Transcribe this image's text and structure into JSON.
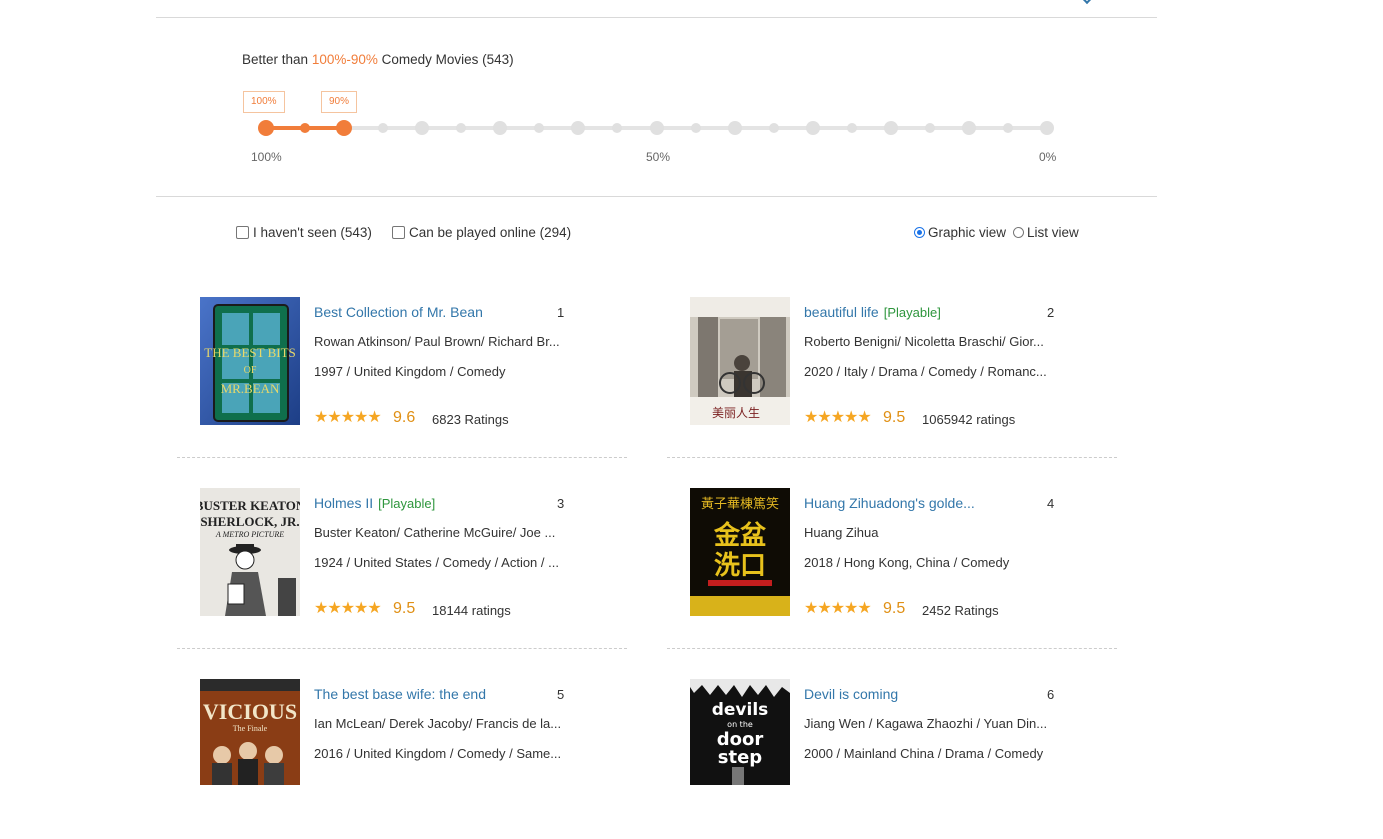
{
  "filter": {
    "prefix": "Better than",
    "range": "100%-90%",
    "suffix": "Comedy Movies (543)",
    "box_left": "100%",
    "box_right": "90%",
    "tick_left": "100%",
    "tick_mid": "50%",
    "tick_right": "0%",
    "selected_from_percent": 100,
    "selected_to_percent": 90
  },
  "options": {
    "not_seen": {
      "label": "I haven't seen",
      "count": "(543)",
      "checked": false
    },
    "playable": {
      "label": "Can be played online",
      "count": "(294)",
      "checked": false
    },
    "view_graphic": "Graphic view",
    "view_list": "List view",
    "selected_view": "Graphic view"
  },
  "colors": {
    "accent": "#f17d3a",
    "link": "#3377aa",
    "playable": "#2e963d",
    "star": "#f5a623"
  },
  "movies": [
    {
      "rank": "1",
      "title": "Best Collection of Mr. Bean",
      "playable": "",
      "cast": "Rowan Atkinson/ Paul Brown/ Richard Br...",
      "info": "1997 / United Kingdom / Comedy",
      "stars": "★★★★★",
      "score": "9.6",
      "votes": "6823 Ratings",
      "poster_text": "THE BEST BITS OF MR.BEAN"
    },
    {
      "rank": "2",
      "title": "beautiful life",
      "playable": "[Playable]",
      "cast": "Roberto Benigni/ Nicoletta Braschi/ Gior...",
      "info": "2020 / Italy / Drama / Comedy / Romanc...",
      "stars": "★★★★★",
      "score": "9.5",
      "votes": "1065942 ratings",
      "poster_text": "美丽人生"
    },
    {
      "rank": "3",
      "title": "Holmes II",
      "playable": "[Playable]",
      "cast": "Buster Keaton/ Catherine McGuire/ Joe ...",
      "info": "1924 / United States / Comedy / Action / ...",
      "stars": "★★★★★",
      "score": "9.5",
      "votes": "18144 ratings",
      "poster_text": "BUSTER KEATON SHERLOCK, JR."
    },
    {
      "rank": "4",
      "title": "Huang Zihuadong's golde...",
      "playable": "",
      "cast": "Huang Zihua",
      "info": "2018 / Hong Kong, China / Comedy",
      "stars": "★★★★★",
      "score": "9.5",
      "votes": "2452 Ratings",
      "poster_text": "金盆洗口"
    },
    {
      "rank": "5",
      "title": "The best base wife: the end",
      "playable": "",
      "cast": "Ian McLean/ Derek Jacoby/ Francis de la...",
      "info": "2016 / United Kingdom / Comedy / Same...",
      "stars": "★★★★★",
      "score": "",
      "votes": "",
      "poster_text": "VICIOUS The Finale"
    },
    {
      "rank": "6",
      "title": "Devil is coming",
      "playable": "",
      "cast": "Jiang Wen / Kagawa Zhaozhi / Yuan Din...",
      "info": "2000 / Mainland China / Drama / Comedy",
      "stars": "★★★★★",
      "score": "",
      "votes": "",
      "poster_text": "devils on the door step"
    }
  ]
}
